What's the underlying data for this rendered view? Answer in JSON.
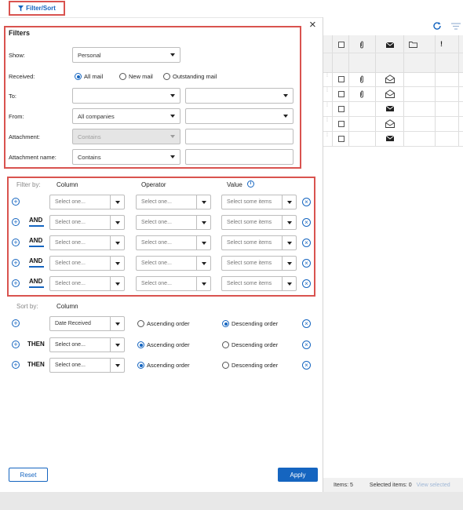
{
  "toolbar": {
    "filter_sort_label": "Filter/Sort"
  },
  "filters": {
    "title": "Filters",
    "show_label": "Show:",
    "show_value": "Personal",
    "received_label": "Received:",
    "received_options": [
      "All mail",
      "New mail",
      "Outstanding mail"
    ],
    "received_selected": "All mail",
    "to_label": "To:",
    "from_label": "From:",
    "from_value": "All companies",
    "attachment_label": "Attachment:",
    "attachment_value": "Contains",
    "attachment_name_label": "Attachment name:",
    "attachment_name_value": "Contains"
  },
  "filter_by": {
    "label": "Filter by:",
    "col_column": "Column",
    "col_operator": "Operator",
    "col_value": "Value",
    "and_label": "AND",
    "rows": [
      {
        "column": "Select one...",
        "operator": "Select one...",
        "value": "Select some items"
      },
      {
        "column": "Select one...",
        "operator": "Select one...",
        "value": "Select some items"
      },
      {
        "column": "Select one...",
        "operator": "Select one...",
        "value": "Select some items"
      },
      {
        "column": "Select one...",
        "operator": "Select one...",
        "value": "Select some items"
      },
      {
        "column": "Select one...",
        "operator": "Select one...",
        "value": "Select some items"
      }
    ]
  },
  "sort_by": {
    "label": "Sort by:",
    "col_column": "Column",
    "then_label": "THEN",
    "asc_label": "Ascending order",
    "desc_label": "Descending order",
    "rows": [
      {
        "column": "Date Received",
        "order": "desc"
      },
      {
        "column": "Select one...",
        "order": "asc"
      },
      {
        "column": "Select one...",
        "order": "asc"
      }
    ]
  },
  "buttons": {
    "reset": "Reset",
    "apply": "Apply"
  },
  "grid": {
    "headers": [
      "",
      "attachment",
      "envelope",
      "folder",
      "!"
    ],
    "importance_header": "!",
    "rows": [
      {
        "attachment": true,
        "mail": "open"
      },
      {
        "attachment": true,
        "mail": "open"
      },
      {
        "attachment": false,
        "mail": "closed"
      },
      {
        "attachment": false,
        "mail": "open"
      },
      {
        "attachment": false,
        "mail": "closed"
      }
    ],
    "status": {
      "items": "Items: 5",
      "selected": "Selected items: 0",
      "view_selected": "View selected"
    }
  },
  "colors": {
    "accent": "#1565c0",
    "highlight_box": "#d9534f"
  }
}
